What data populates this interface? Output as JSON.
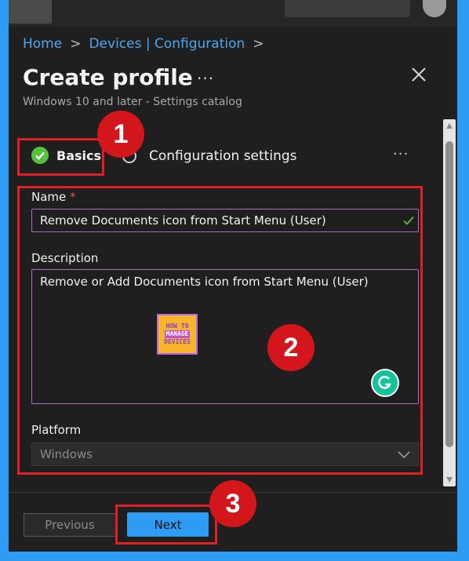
{
  "breadcrumb": {
    "home": "Home",
    "devices": "Devices | Configuration",
    "sep": ">"
  },
  "header": {
    "title": "Create profile",
    "more": "···",
    "subtitle": "Windows 10 and later - Settings catalog"
  },
  "steps": {
    "basics": "Basics",
    "configuration": "Configuration settings",
    "more": "···"
  },
  "form": {
    "name_label": "Name",
    "required_mark": "*",
    "name_value": "Remove Documents icon from Start Menu (User)",
    "description_label": "Description",
    "description_value": "Remove or Add Documents icon from Start Menu (User)",
    "platform_label": "Platform",
    "platform_value": "Windows"
  },
  "logo": {
    "line1": "HOW TO",
    "line2": "MANAGE",
    "line3": "DEVICES"
  },
  "annotations": {
    "badge1": "1",
    "badge2": "2",
    "badge3": "3"
  },
  "footer": {
    "previous": "Previous",
    "next": "Next"
  },
  "colors": {
    "accent": "#2f9cf4",
    "link": "#4ea6ee",
    "success": "#58c23a",
    "highlight_red": "#e01e25",
    "input_border": "#b06bc2"
  }
}
